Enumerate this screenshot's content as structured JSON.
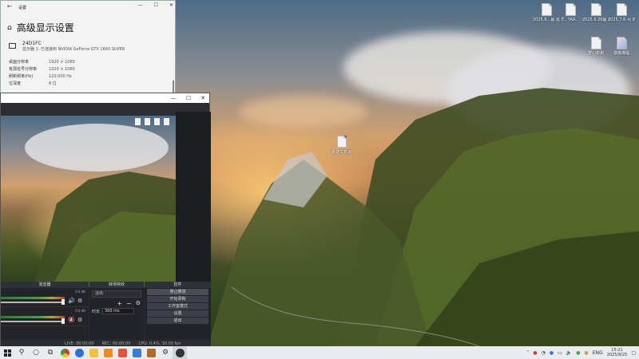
{
  "settings_window": {
    "title": "设置",
    "heading": "高级显示设置",
    "monitor": {
      "name": "24D1FC",
      "detail": "显示器 1: 已连接到 NVIDIA GeForce GTX 1660 SUPER"
    },
    "rows": [
      {
        "key": "桌面分辨率",
        "value": "1920 × 1080"
      },
      {
        "key": "有源信号分辨率",
        "value": "1920 × 1080"
      },
      {
        "key": "刷新频率(Hz)",
        "value": "120.000 Hz"
      },
      {
        "key": "位深度",
        "value": "8 位"
      }
    ]
  },
  "desktop_icons": [
    {
      "label": "2025.6...最 需完..."
    },
    {
      "label": "E...YAR..."
    },
    {
      "label": "2025.6.26最 需完成(N..."
    },
    {
      "label": "2025.7.6-另 的5天-同计..."
    },
    {
      "label": "梦幻谢谢"
    },
    {
      "label": "镜像降临"
    }
  ],
  "center_file": {
    "label": "新建文件夹"
  },
  "obs": {
    "docks": {
      "mixer_title": "混音器",
      "transitions_title": "转场特效",
      "controls_title": "控件"
    },
    "mixer_rows": [
      {
        "db": "0.0 dB"
      },
      {
        "db": "0.0 dB"
      }
    ],
    "transition": {
      "selected": "淡出",
      "duration_label": "时长",
      "duration_value": "300 ms"
    },
    "controls": [
      {
        "label": "停止推流"
      },
      {
        "label": "开始录制"
      },
      {
        "label": "工作室模式"
      },
      {
        "label": "设置"
      },
      {
        "label": "退出"
      }
    ],
    "status": {
      "live_label": "LIVE: 00:00:00",
      "rec_label": "REC: 00:00:00",
      "cpu_label": "CPU: 0.4%, 30.00 fps"
    }
  },
  "taskbar": {
    "lang": "ENG",
    "time": "15:21",
    "date": "2025/8/25"
  }
}
